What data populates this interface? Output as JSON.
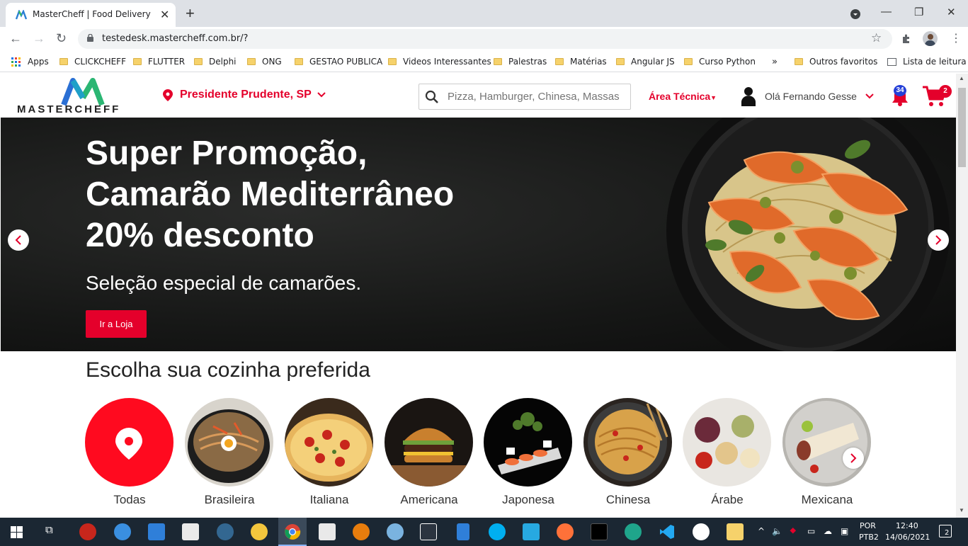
{
  "browser": {
    "tab_title": "MasterCheff | Food Delivery",
    "url": "testedesk.mastercheff.com.br/?",
    "bookmarks": [
      "Apps",
      "CLICKCHEFF",
      "FLUTTER",
      "Delphi",
      "ONG",
      "GESTAO PUBLICA",
      "Videos Interessantes",
      "Palestras",
      "Matérias",
      "Angular JS",
      "Curso Python"
    ],
    "bookmarks_overflow": "»",
    "other_favorites": "Outros favoritos",
    "reading_list": "Lista de leitura"
  },
  "header": {
    "logo_text": "MASTERCHEFF",
    "location": "Presidente Prudente, SP",
    "search_placeholder": "Pizza, Hamburger, Chinesa, Massas",
    "technical_area": "Área Técnica",
    "user_greeting": "Olá Fernando Gesse",
    "notifications_count": "34",
    "cart_count": "2"
  },
  "hero": {
    "title_line1": "Super Promoção,",
    "title_line2": "Camarão Mediterrâneo",
    "title_line3": "20% desconto",
    "subtitle": "Seleção especial de camarões.",
    "cta": "Ir a Loja"
  },
  "cuisines": {
    "heading": "Escolha sua cozinha preferida",
    "items": [
      "Todas",
      "Brasileira",
      "Italiana",
      "Americana",
      "Japonesa",
      "Chinesa",
      "Árabe",
      "Mexicana"
    ]
  },
  "taskbar": {
    "lang_line1": "POR",
    "lang_line2": "PTB2",
    "time": "12:40",
    "date": "14/06/2021",
    "notifications": "2"
  },
  "colors": {
    "brand_red": "#e4002b",
    "taskbar": "#1b2733"
  }
}
